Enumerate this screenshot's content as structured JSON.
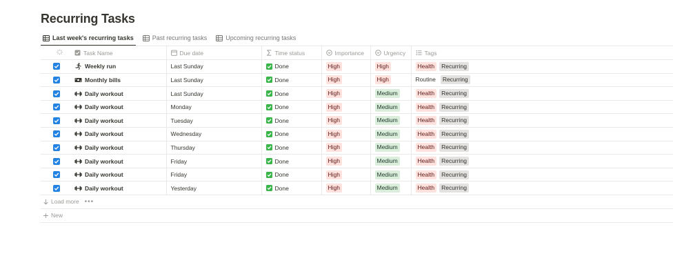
{
  "page": {
    "title": "Recurring Tasks"
  },
  "tabs": [
    {
      "label": "Last week's recurring tasks",
      "active": true,
      "icon": "table-icon"
    },
    {
      "label": "Past recurring tasks",
      "active": false,
      "icon": "table-icon"
    },
    {
      "label": "Upcoming recurring tasks",
      "active": false,
      "icon": "table-icon"
    }
  ],
  "columns": {
    "task_name": "Task Name",
    "due_date": "Due date",
    "time_status": "Time status",
    "importance": "Importance",
    "urgency": "Urgency",
    "tags": "Tags"
  },
  "rows": [
    {
      "checked": true,
      "icon": "running-person-icon",
      "name": "Weekly run",
      "due": "Last Sunday",
      "status": "Done",
      "importance": "High",
      "urgency": "High",
      "urgency_color": "red",
      "tag1": "Health",
      "tag1_style": "red",
      "tag2": "Recurring"
    },
    {
      "checked": true,
      "icon": "bill-icon",
      "name": "Monthly bills",
      "due": "Last Sunday",
      "status": "Done",
      "importance": "High",
      "urgency": "High",
      "urgency_color": "red",
      "tag1": "Routine",
      "tag1_style": "plain",
      "tag2": "Recurring"
    },
    {
      "checked": true,
      "icon": "dumbbell-icon",
      "name": "Daily workout",
      "due": "Last Sunday",
      "status": "Done",
      "importance": "High",
      "urgency": "Medium",
      "urgency_color": "green",
      "tag1": "Health",
      "tag1_style": "red",
      "tag2": "Recurring"
    },
    {
      "checked": true,
      "icon": "dumbbell-icon",
      "name": "Daily workout",
      "due": "Monday",
      "status": "Done",
      "importance": "High",
      "urgency": "Medium",
      "urgency_color": "green",
      "tag1": "Health",
      "tag1_style": "red",
      "tag2": "Recurring"
    },
    {
      "checked": true,
      "icon": "dumbbell-icon",
      "name": "Daily workout",
      "due": "Tuesday",
      "status": "Done",
      "importance": "High",
      "urgency": "Medium",
      "urgency_color": "green",
      "tag1": "Health",
      "tag1_style": "red",
      "tag2": "Recurring"
    },
    {
      "checked": true,
      "icon": "dumbbell-icon",
      "name": "Daily workout",
      "due": "Wednesday",
      "status": "Done",
      "importance": "High",
      "urgency": "Medium",
      "urgency_color": "green",
      "tag1": "Health",
      "tag1_style": "red",
      "tag2": "Recurring"
    },
    {
      "checked": true,
      "icon": "dumbbell-icon",
      "name": "Daily workout",
      "due": "Thursday",
      "status": "Done",
      "importance": "High",
      "urgency": "Medium",
      "urgency_color": "green",
      "tag1": "Health",
      "tag1_style": "red",
      "tag2": "Recurring"
    },
    {
      "checked": true,
      "icon": "dumbbell-icon",
      "name": "Daily workout",
      "due": "Friday",
      "status": "Done",
      "importance": "High",
      "urgency": "Medium",
      "urgency_color": "green",
      "tag1": "Health",
      "tag1_style": "red",
      "tag2": "Recurring"
    },
    {
      "checked": true,
      "icon": "dumbbell-icon",
      "name": "Daily workout",
      "due": "Friday",
      "status": "Done",
      "importance": "High",
      "urgency": "Medium",
      "urgency_color": "green",
      "tag1": "Health",
      "tag1_style": "red",
      "tag2": "Recurring"
    },
    {
      "checked": true,
      "icon": "dumbbell-icon",
      "name": "Daily workout",
      "due": "Yesterday",
      "status": "Done",
      "importance": "High",
      "urgency": "Medium",
      "urgency_color": "green",
      "tag1": "Health",
      "tag1_style": "red",
      "tag2": "Recurring"
    }
  ],
  "footer": {
    "load_more": "Load more",
    "more_dots": "•••",
    "new": "New"
  },
  "colors": {
    "checkbox_blue": "#2383e2",
    "done_green": "#3ab54a",
    "tag_red_bg": "#ffe2dd",
    "tag_green_bg": "#dbeddb",
    "tag_gray_bg": "#e3e2e0"
  }
}
